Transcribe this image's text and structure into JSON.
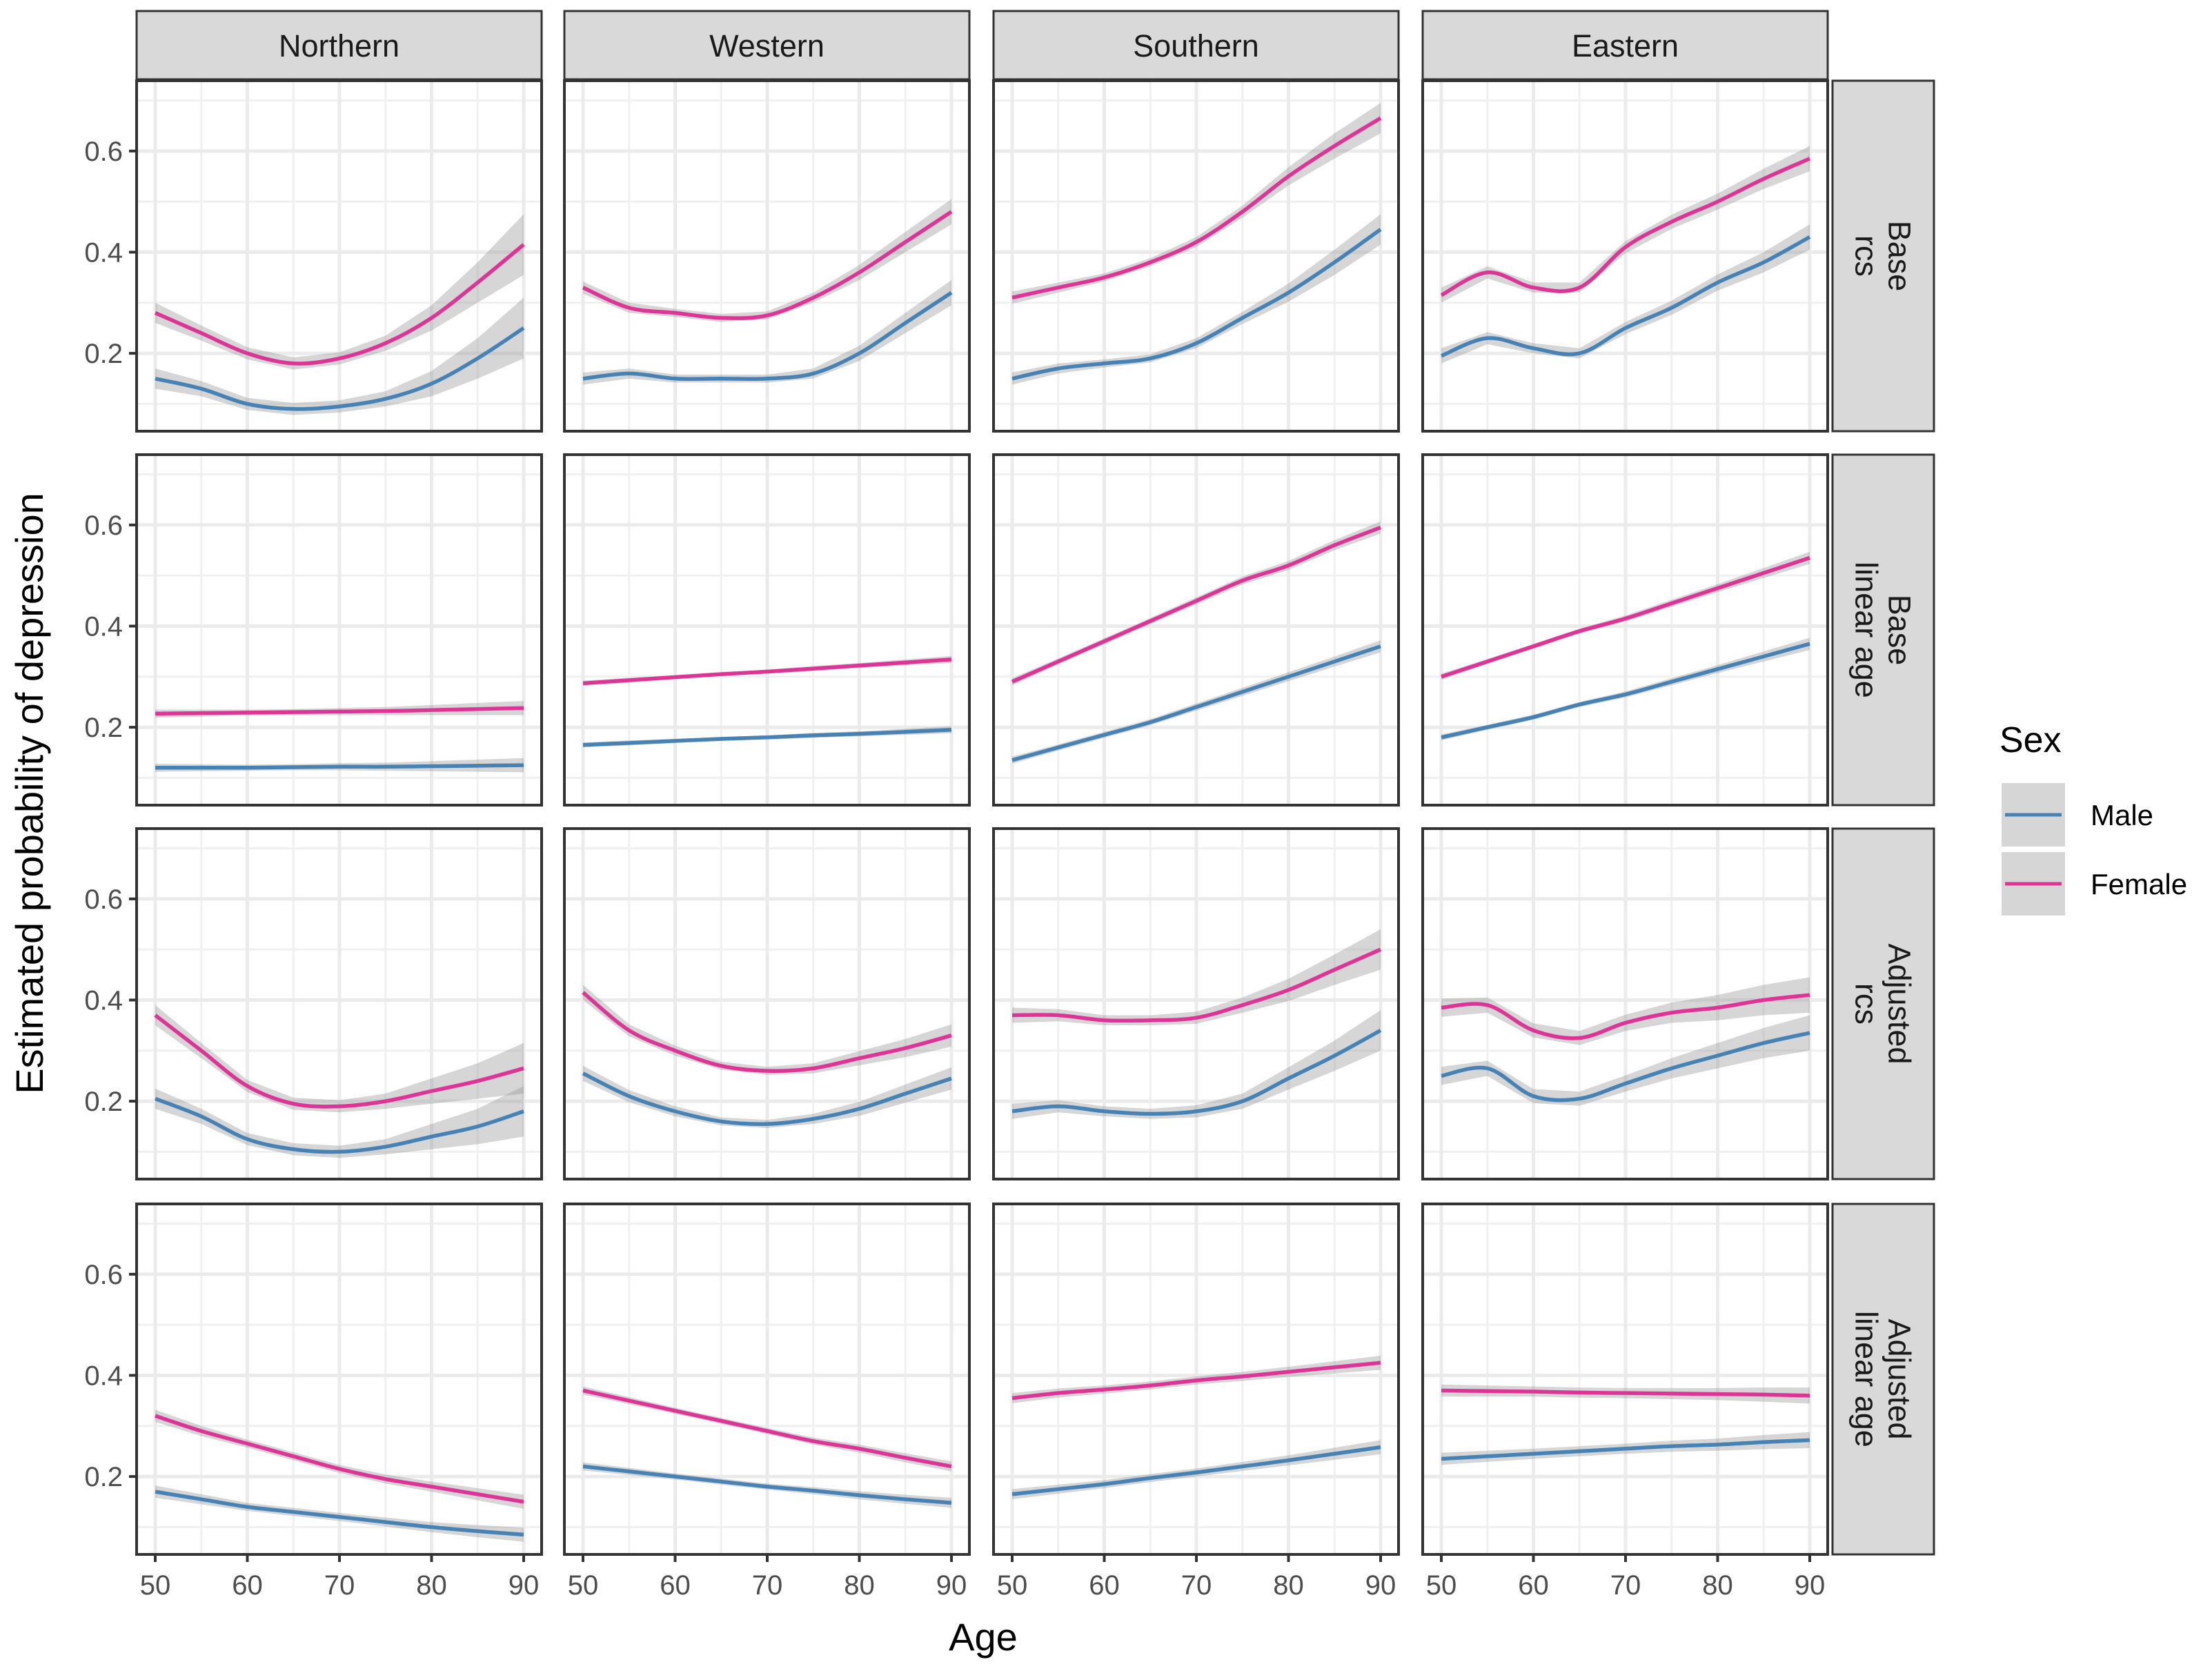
{
  "chart_data": {
    "type": "line",
    "title": "",
    "xlabel": "Age",
    "ylabel": "Estimated probability of depression",
    "xlim": [
      48,
      92
    ],
    "ylim": [
      0.046,
      0.739
    ],
    "x_ticks": [
      50,
      60,
      70,
      80,
      90
    ],
    "x_tick_labels": [
      "50",
      "60",
      "70",
      "80",
      "90"
    ],
    "y_ticks": [
      0.2,
      0.4,
      0.6
    ],
    "y_tick_labels": [
      "0.2",
      "0.4",
      "0.6"
    ],
    "grid": true,
    "facet_columns": [
      "Northern",
      "Western",
      "Southern",
      "Eastern"
    ],
    "facet_rows": [
      {
        "line1": "Base",
        "line2": "rcs"
      },
      {
        "line1": "Base",
        "line2": "linear age"
      },
      {
        "line1": "Adjusted",
        "line2": "rcs"
      },
      {
        "line1": "Adjusted",
        "line2": "linear age"
      }
    ],
    "legend": {
      "title": "Sex",
      "position": "right",
      "entries": [
        {
          "name": "Male",
          "color": "#4682B4"
        },
        {
          "name": "Female",
          "color": "#DD3497"
        }
      ]
    },
    "x": [
      50,
      55,
      60,
      65,
      70,
      75,
      80,
      85,
      90
    ],
    "panels": [
      [
        {
          "Male": [
            0.15,
            0.13,
            0.1,
            0.09,
            0.095,
            0.11,
            0.14,
            0.19,
            0.25
          ],
          "Female": [
            0.28,
            0.24,
            0.2,
            0.18,
            0.19,
            0.22,
            0.27,
            0.34,
            0.415
          ],
          "ci": [
            0.02,
            0.015,
            0.012,
            0.012,
            0.012,
            0.015,
            0.025,
            0.04,
            0.06
          ]
        },
        {
          "Male": [
            0.15,
            0.16,
            0.15,
            0.15,
            0.15,
            0.16,
            0.2,
            0.26,
            0.32
          ],
          "Female": [
            0.33,
            0.29,
            0.28,
            0.27,
            0.275,
            0.31,
            0.36,
            0.42,
            0.48
          ],
          "ci": [
            0.012,
            0.01,
            0.008,
            0.008,
            0.008,
            0.01,
            0.015,
            0.02,
            0.025
          ]
        },
        {
          "Male": [
            0.15,
            0.17,
            0.18,
            0.19,
            0.22,
            0.27,
            0.32,
            0.38,
            0.445
          ],
          "Female": [
            0.31,
            0.33,
            0.35,
            0.38,
            0.42,
            0.48,
            0.55,
            0.61,
            0.665
          ],
          "ci": [
            0.012,
            0.01,
            0.008,
            0.008,
            0.01,
            0.012,
            0.018,
            0.025,
            0.03
          ]
        },
        {
          "Male": [
            0.195,
            0.23,
            0.21,
            0.2,
            0.25,
            0.29,
            0.34,
            0.38,
            0.43
          ],
          "Female": [
            0.315,
            0.36,
            0.33,
            0.33,
            0.41,
            0.46,
            0.5,
            0.545,
            0.585
          ],
          "ci": [
            0.015,
            0.012,
            0.01,
            0.01,
            0.012,
            0.014,
            0.016,
            0.02,
            0.025
          ]
        }
      ],
      [
        {
          "Male": [
            0.12,
            0.12,
            0.12,
            0.121,
            0.122,
            0.122,
            0.123,
            0.124,
            0.125
          ],
          "Female": [
            0.227,
            0.228,
            0.229,
            0.23,
            0.231,
            0.232,
            0.234,
            0.236,
            0.238
          ],
          "ci": [
            0.008,
            0.007,
            0.006,
            0.006,
            0.007,
            0.008,
            0.01,
            0.012,
            0.014
          ]
        },
        {
          "Male": [
            0.165,
            0.169,
            0.173,
            0.177,
            0.18,
            0.184,
            0.187,
            0.191,
            0.195
          ],
          "Female": [
            0.287,
            0.293,
            0.299,
            0.305,
            0.31,
            0.316,
            0.322,
            0.328,
            0.334
          ],
          "ci": [
            0.005,
            0.005,
            0.004,
            0.004,
            0.004,
            0.005,
            0.005,
            0.006,
            0.007
          ]
        },
        {
          "Male": [
            0.135,
            0.16,
            0.185,
            0.21,
            0.24,
            0.27,
            0.3,
            0.33,
            0.36
          ],
          "Female": [
            0.29,
            0.33,
            0.37,
            0.41,
            0.45,
            0.49,
            0.52,
            0.56,
            0.595
          ],
          "ci": [
            0.007,
            0.006,
            0.006,
            0.006,
            0.007,
            0.008,
            0.009,
            0.01,
            0.012
          ]
        },
        {
          "Male": [
            0.18,
            0.2,
            0.22,
            0.245,
            0.265,
            0.29,
            0.315,
            0.34,
            0.365
          ],
          "Female": [
            0.3,
            0.33,
            0.36,
            0.39,
            0.415,
            0.445,
            0.475,
            0.505,
            0.535
          ],
          "ci": [
            0.006,
            0.005,
            0.005,
            0.005,
            0.006,
            0.007,
            0.008,
            0.01,
            0.012
          ]
        }
      ],
      [
        {
          "Male": [
            0.205,
            0.17,
            0.125,
            0.105,
            0.1,
            0.11,
            0.13,
            0.15,
            0.18
          ],
          "Female": [
            0.37,
            0.3,
            0.23,
            0.195,
            0.19,
            0.2,
            0.22,
            0.24,
            0.265
          ],
          "ci": [
            0.02,
            0.015,
            0.012,
            0.012,
            0.012,
            0.015,
            0.025,
            0.035,
            0.05
          ]
        },
        {
          "Male": [
            0.255,
            0.21,
            0.18,
            0.16,
            0.155,
            0.165,
            0.185,
            0.215,
            0.245
          ],
          "Female": [
            0.415,
            0.34,
            0.3,
            0.27,
            0.26,
            0.265,
            0.285,
            0.305,
            0.33
          ],
          "ci": [
            0.015,
            0.012,
            0.01,
            0.008,
            0.008,
            0.01,
            0.014,
            0.018,
            0.022
          ]
        },
        {
          "Male": [
            0.18,
            0.19,
            0.18,
            0.175,
            0.18,
            0.2,
            0.245,
            0.29,
            0.34
          ],
          "Female": [
            0.37,
            0.37,
            0.36,
            0.36,
            0.365,
            0.39,
            0.42,
            0.46,
            0.5
          ],
          "ci": [
            0.015,
            0.012,
            0.01,
            0.01,
            0.012,
            0.015,
            0.022,
            0.03,
            0.04
          ]
        },
        {
          "Male": [
            0.25,
            0.265,
            0.21,
            0.205,
            0.235,
            0.265,
            0.29,
            0.315,
            0.335
          ],
          "Female": [
            0.385,
            0.39,
            0.34,
            0.325,
            0.355,
            0.375,
            0.385,
            0.4,
            0.41
          ],
          "ci": [
            0.018,
            0.015,
            0.014,
            0.014,
            0.016,
            0.02,
            0.025,
            0.03,
            0.035
          ]
        }
      ],
      [
        {
          "Male": [
            0.17,
            0.155,
            0.14,
            0.13,
            0.12,
            0.11,
            0.1,
            0.092,
            0.085
          ],
          "Female": [
            0.32,
            0.29,
            0.265,
            0.24,
            0.215,
            0.195,
            0.18,
            0.165,
            0.15
          ],
          "ci": [
            0.012,
            0.01,
            0.008,
            0.008,
            0.008,
            0.009,
            0.01,
            0.012,
            0.014
          ]
        },
        {
          "Male": [
            0.22,
            0.21,
            0.2,
            0.19,
            0.18,
            0.172,
            0.163,
            0.155,
            0.148
          ],
          "Female": [
            0.37,
            0.35,
            0.33,
            0.31,
            0.29,
            0.27,
            0.255,
            0.237,
            0.22
          ],
          "ci": [
            0.008,
            0.007,
            0.006,
            0.006,
            0.006,
            0.007,
            0.008,
            0.009,
            0.01
          ]
        },
        {
          "Male": [
            0.165,
            0.175,
            0.185,
            0.197,
            0.208,
            0.22,
            0.232,
            0.245,
            0.258
          ],
          "Female": [
            0.355,
            0.365,
            0.372,
            0.38,
            0.39,
            0.398,
            0.407,
            0.416,
            0.425
          ],
          "ci": [
            0.01,
            0.009,
            0.008,
            0.008,
            0.008,
            0.009,
            0.01,
            0.012,
            0.014
          ]
        },
        {
          "Male": [
            0.235,
            0.24,
            0.245,
            0.25,
            0.255,
            0.26,
            0.263,
            0.268,
            0.272
          ],
          "Female": [
            0.37,
            0.369,
            0.368,
            0.366,
            0.365,
            0.364,
            0.363,
            0.362,
            0.36
          ],
          "ci": [
            0.012,
            0.011,
            0.01,
            0.01,
            0.01,
            0.011,
            0.012,
            0.014,
            0.016
          ]
        }
      ]
    ]
  }
}
